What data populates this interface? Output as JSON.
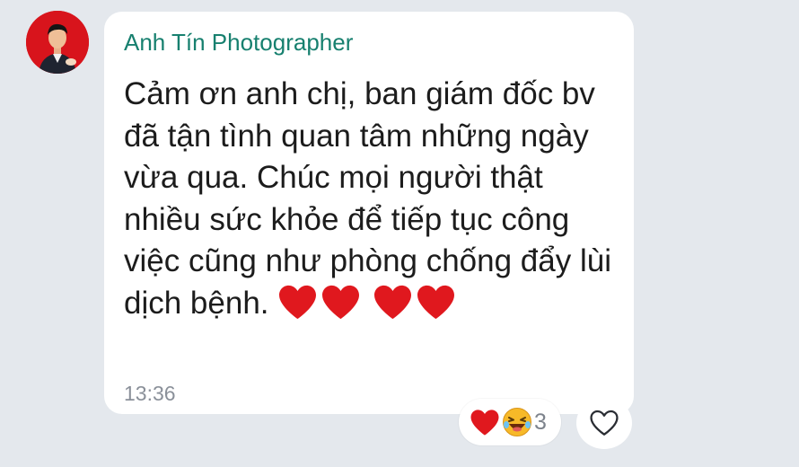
{
  "message": {
    "sender_name": "Anh Tín Photographer",
    "text": "Cảm ơn anh chị, ban giám đốc bv đã tận tình quan tâm những ngày vừa qua. Chúc mọi người thật nhiều sức khỏe để tiếp tục công việc cũng như phòng chống đẩy lùi dịch bệnh.",
    "emoji": [
      "red-heart",
      "red-heart",
      "red-heart",
      "red-heart"
    ],
    "time": "13:36"
  },
  "reactions": {
    "icons": [
      "red-heart",
      "laughing-face"
    ],
    "count": "3"
  },
  "actions": {
    "react_icon": "heart-outline-icon"
  },
  "colors": {
    "background": "#e4e8ed",
    "bubble": "#ffffff",
    "sender_name": "#17806f",
    "message_text": "#1c1c1c",
    "timestamp": "#8a9099",
    "heart": "#e0181e",
    "avatar_background": "#d8141c"
  }
}
